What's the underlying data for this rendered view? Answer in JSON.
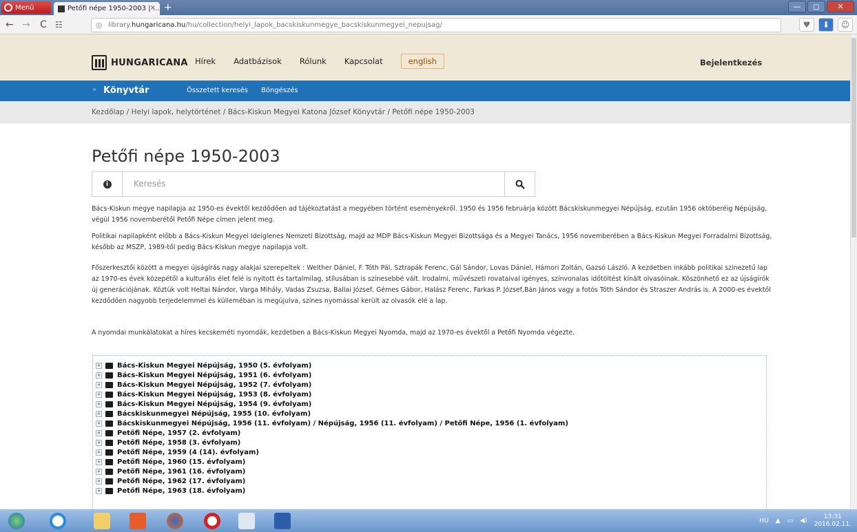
{
  "browser": {
    "menu_label": "Menü",
    "tab_title": "Petőfi népe 1950-2003 | ...",
    "tab_close": "×",
    "new_tab": "+",
    "url_prefix": "library.",
    "url_domain": "hungaricana.hu",
    "url_path": "/hu/collection/helyi_lapok_bacskiskunmegye_bacskiskunmegyei_nepujsag/"
  },
  "header": {
    "logo_text": "HUNGARICANA",
    "nav": [
      "Hírek",
      "Adatbázisok",
      "Rólunk",
      "Kapcsolat"
    ],
    "english": "english",
    "login": "Bejelentkezés"
  },
  "subnav": {
    "section": "Könyvtár",
    "links": [
      "Összetett keresés",
      "Böngészés"
    ]
  },
  "breadcrumb": "Kezdőlap  /  Helyi lapok, helytörténet  /  Bács-Kiskun Megyei Katona József Könyvtár  /  Petőfi népe 1950-2003",
  "page": {
    "title": "Petőfi népe 1950-2003",
    "search_placeholder": "Keresés"
  },
  "description": [
    "Bács-Kiskun megye napilapja az 1950-es évektől kezdődően ad tájékoztatást a megyében történt eseményekről. 1950 és 1956 februárja között Bácskiskunmegyei Népújság, ezután 1956 októberéig Népújság, végül 1956 novemberétől Petőfi Népe címen jelent meg.",
    "Politikai napilapként előbb a Bács-Kiskun Megyei Ideiglenes Nemzeti Bizottság, majd az MDP Bács-Kiskun Megyei Bizottsága és a Megyei Tanács, 1956 novemberében a Bács-Kiskun Megyei Forradalmi Bizottság, később az MSZP, 1989-től pedig Bács-Kiskun megye napilapja volt.",
    "Főszerkesztői között a megyei újságírás nagy alakjai szerepeltek : Welther Dániel, F. Tóth Pál, Sztrapák Ferenc, Gál Sándor, Lovas Dániel, Hámori Zoltán, Gazsó László. A kezdetben inkább politikai színezetű lap az 1970-es évek közepétől a kulturális élet felé is nyitott és tartalmilag, stílusában is színesebbé vált. Irodalmi, művészeti rovataival igényes, színvonalas időtöltést kínált olvasóinak. Köszönhető ez az újságírók új generációjának. Köztük volt Heltai Nándor, Varga Mihály, Vadas Zsuzsa, Ballai József, Gémes Gábor, Halász Ferenc, Farkas P. József,Bán János vagy a fotós Tóth Sándor és Straszer András is. A 2000-es évektől kezdődően nagyobb terjedelemmel és külleméban is megújulva, színes nyomással került az olvasók elé a lap.",
    "A nyomdai munkálatokat a híres kecskeméti nyomdák, kezdetben a Bács-Kiskun Megyei Nyomda, majd az 1970-es évektől a Petőfi Nyomda végezte."
  ],
  "tree": [
    "Bács-Kiskun Megyei Népújság, 1950 (5. évfolyam)",
    "Bács-Kiskun Megyei Népújság, 1951 (6. évfolyam)",
    "Bács-Kiskun Megyei Népújság, 1952 (7. évfolyam)",
    "Bács-Kiskun Megyei Népújság, 1953 (8. évfolyam)",
    "Bács-Kiskun Megyei Népújság, 1954 (9. évfolyam)",
    "Bácskiskunmegyei Népújság, 1955 (10. évfolyam)",
    "Bácskiskunmegyei Népújság, 1956 (11. évfolyam) / Népújság, 1956 (11. évfolyam) / Petőfi Népe, 1956 (1. évfolyam)",
    "Petőfi Népe, 1957 (2. évfolyam)",
    "Petőfi Népe, 1958 (3. évfolyam)",
    "Petőfi Népe, 1959 (4 (14). évfolyam)",
    "Petőfi Népe, 1960 (15. évfolyam)",
    "Petőfi Népe, 1961 (16. évfolyam)",
    "Petőfi Népe, 1962 (17. évfolyam)",
    "Petőfi Népe, 1963 (18. évfolyam)"
  ],
  "taskbar": {
    "lang": "HU",
    "time": "13:31",
    "date": "2016.02.11."
  },
  "colors": {
    "header_bg": "#efe8d6",
    "blue_bar": "#1f72b8",
    "breadcrumb_bg": "#e9e9e9"
  }
}
